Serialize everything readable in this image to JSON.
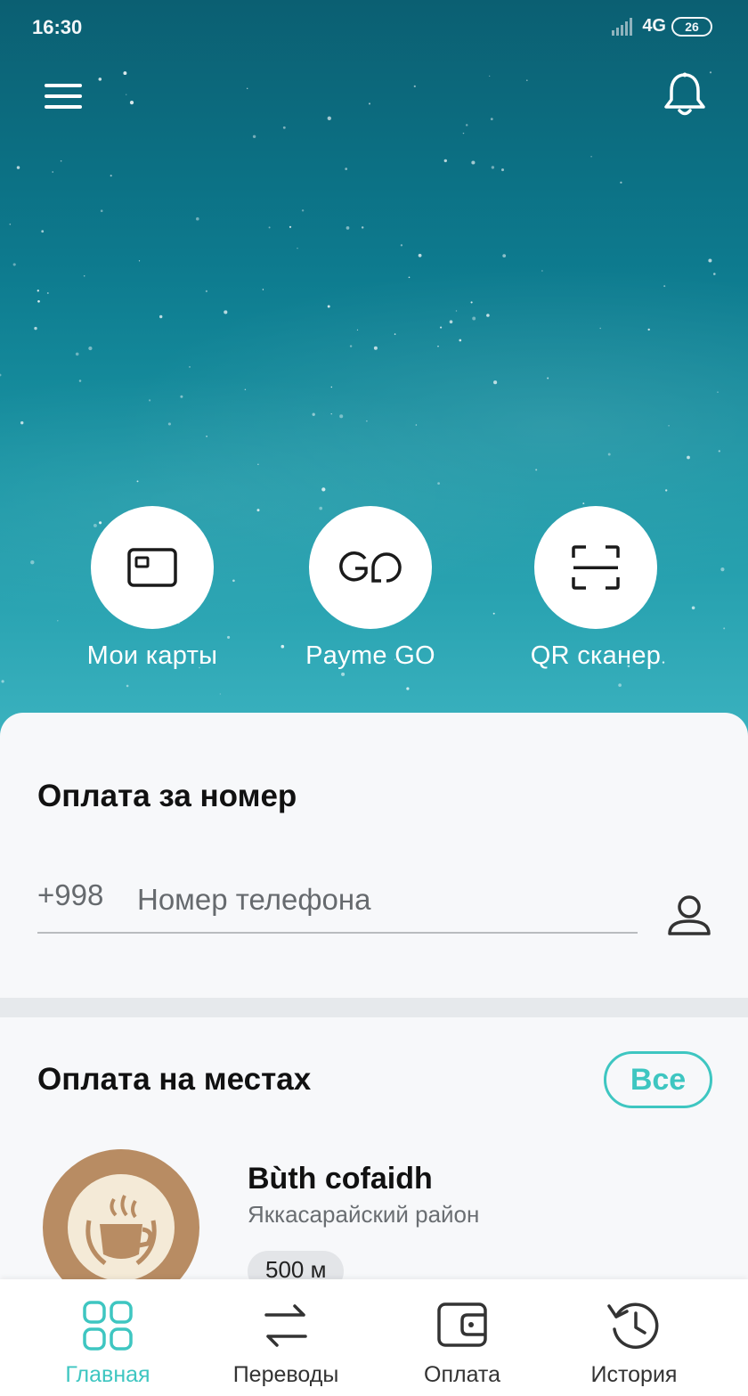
{
  "status_bar": {
    "time": "16:30",
    "network": "4G",
    "battery": "26"
  },
  "header": {
    "menu_icon": "hamburger-menu-icon",
    "notifications_icon": "bell-icon"
  },
  "quick_actions": [
    {
      "label": "Мои карты",
      "icon": "card-icon"
    },
    {
      "label": "Payme GO",
      "icon": "go-logo-icon"
    },
    {
      "label": "QR сканер",
      "icon": "qr-scan-icon"
    }
  ],
  "phone_payment": {
    "title": "Оплата за номер",
    "prefix": "+998",
    "placeholder": "Номер телефона",
    "contact_icon": "person-icon"
  },
  "places": {
    "title": "Оплата на местах",
    "all_label": "Все",
    "items": [
      {
        "name": "Bùth cofaidh",
        "district": "Яккасарайский район",
        "distance": "500 м",
        "logo": "coffee-cup-logo"
      }
    ]
  },
  "nav": {
    "items": [
      {
        "label": "Главная",
        "icon": "grid-icon",
        "active": true
      },
      {
        "label": "Переводы",
        "icon": "transfer-arrows-icon",
        "active": false
      },
      {
        "label": "Оплата",
        "icon": "wallet-icon",
        "active": false
      },
      {
        "label": "История",
        "icon": "history-clock-icon",
        "active": false
      }
    ]
  },
  "colors": {
    "accent": "#3ec6c1",
    "hero_top": "#0b5f72",
    "hero_bottom": "#3cb3c0",
    "card_bg": "#f7f8fa"
  }
}
